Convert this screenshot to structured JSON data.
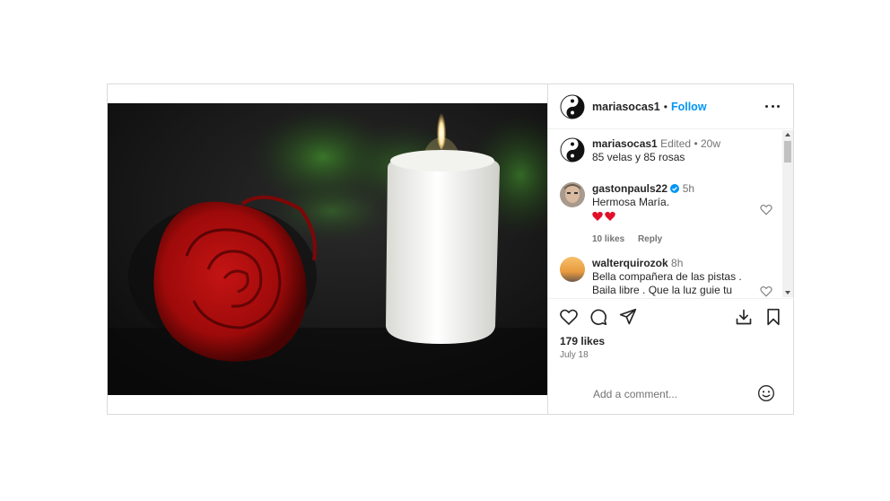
{
  "post": {
    "author": "mariasocas1",
    "follow_separator": "•",
    "follow_label": "Follow",
    "caption": {
      "username": "mariasocas1",
      "edited": "Edited",
      "separator": "•",
      "time": "20w",
      "text": "85 velas y 85 rosas"
    },
    "comments": [
      {
        "username": "gastonpauls22",
        "verified": true,
        "time": "5h",
        "text": "Hermosa María.",
        "emoji": "❤❤",
        "likes": "10 likes",
        "reply": "Reply"
      },
      {
        "username": "walterquirozok",
        "time": "8h",
        "text": "Bella compañera de las pistas . Baila libre . Que la luz guie tu camino 🙏"
      }
    ],
    "likes": "179 likes",
    "date": "July 18",
    "add_comment_placeholder": "Add a comment..."
  },
  "icons": [
    "more-options-icon",
    "heart-icon",
    "comment-icon",
    "share-icon",
    "save-icon",
    "download-icon",
    "emoji-icon",
    "verified-badge-icon"
  ],
  "colors": {
    "accent": "#0095f6",
    "text": "#262626",
    "muted": "#737373",
    "like_red": "#ed4956"
  }
}
